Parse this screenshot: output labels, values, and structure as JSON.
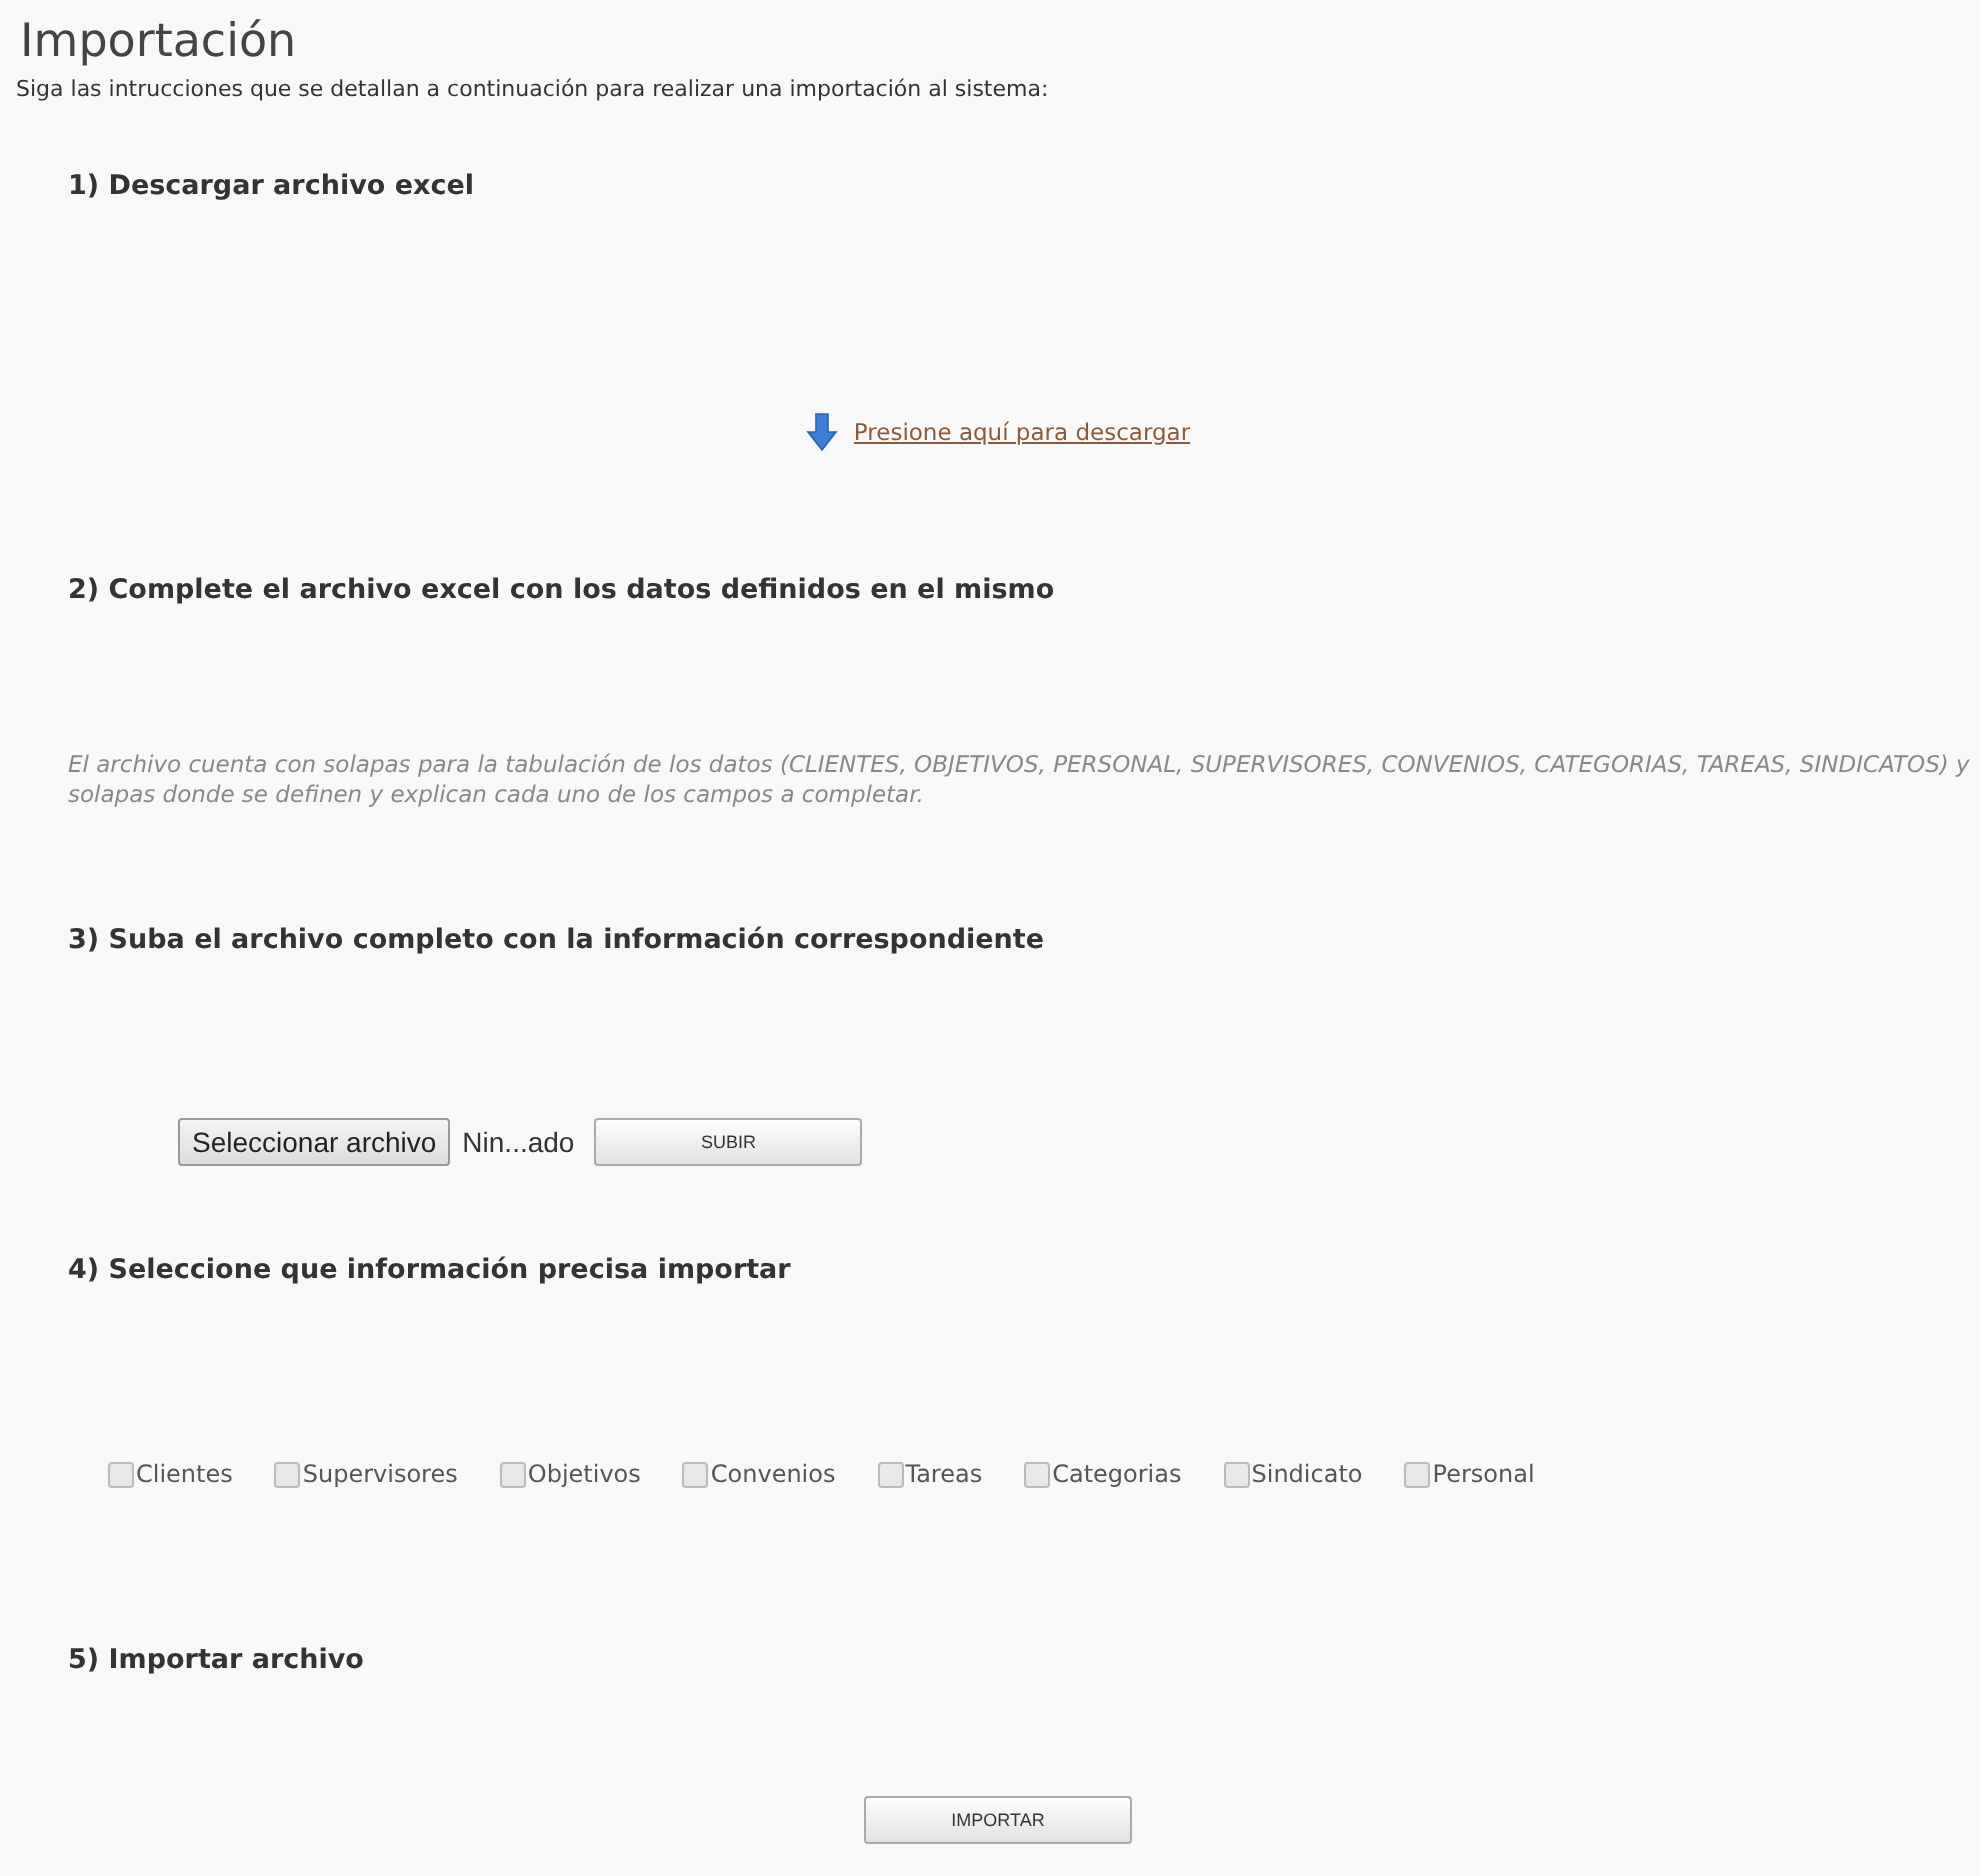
{
  "title": "Importación",
  "intro": "Siga las intrucciones que se detallan a continuación para realizar una importación al sistema:",
  "steps": [
    {
      "kind": "download",
      "heading": "1) Descargar archivo excel",
      "link": "Presione aquí para descargar"
    },
    {
      "kind": "note",
      "heading": "2) Complete el archivo excel con los datos definidos en el mismo",
      "note": "El archivo cuenta con solapas para la tabulación de los datos (CLIENTES, OBJETIVOS, PERSONAL, SUPERVISORES, CONVENIOS, CATEGORIAS, TAREAS, SINDICATOS) y solapas donde se definen y explican cada uno de los campos a completar."
    },
    {
      "kind": "upload",
      "heading": "3) Suba el archivo completo con la información correspondiente",
      "file_button": "Seleccionar archivo",
      "file_status": "Nin...ado",
      "upload_button": "SUBIR"
    },
    {
      "kind": "checks",
      "heading": "4) Seleccione que información precisa importar",
      "options": [
        {
          "label": "Clientes",
          "checked": false
        },
        {
          "label": "Supervisores",
          "checked": false
        },
        {
          "label": "Objetivos",
          "checked": false
        },
        {
          "label": "Convenios",
          "checked": false
        },
        {
          "label": "Tareas",
          "checked": false
        },
        {
          "label": "Categorias",
          "checked": false
        },
        {
          "label": "Sindicato",
          "checked": false
        },
        {
          "label": "Personal",
          "checked": false
        }
      ]
    },
    {
      "kind": "import",
      "heading": "5) Importar archivo",
      "button": "IMPORTAR"
    }
  ]
}
